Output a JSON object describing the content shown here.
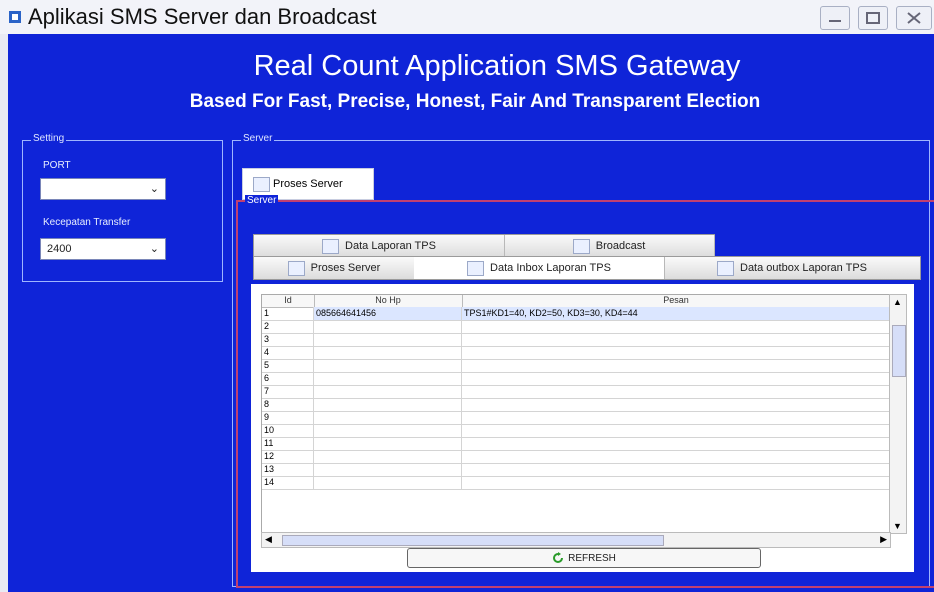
{
  "window": {
    "title": "Aplikasi SMS Server dan Broadcast"
  },
  "header": {
    "title": "Real Count Application SMS Gateway",
    "subtitle": "Based For Fast, Precise, Honest, Fair And Transparent Election"
  },
  "setting": {
    "group_title": "Setting",
    "port_label": "PORT",
    "port_value": "",
    "speed_label": "Kecepatan Transfer",
    "speed_value": "2400"
  },
  "server": {
    "group_title": "Server",
    "top_tab_label": "Proses Server",
    "panel_title": "Server",
    "tabs_row1": [
      "Data Laporan TPS",
      "Broadcast"
    ],
    "tabs_row2": [
      "Proses Server",
      "Data Inbox Laporan TPS",
      "Data outbox Laporan TPS"
    ]
  },
  "table": {
    "columns": [
      "Id",
      "No Hp",
      "Pesan"
    ],
    "rows": [
      {
        "id": "1",
        "phone": "085664641456",
        "message": "TPS1#KD1=40, KD2=50, KD3=30, KD4=44"
      },
      {
        "id": "2",
        "phone": "",
        "message": ""
      },
      {
        "id": "3",
        "phone": "",
        "message": ""
      },
      {
        "id": "4",
        "phone": "",
        "message": ""
      },
      {
        "id": "5",
        "phone": "",
        "message": ""
      },
      {
        "id": "6",
        "phone": "",
        "message": ""
      },
      {
        "id": "7",
        "phone": "",
        "message": ""
      },
      {
        "id": "8",
        "phone": "",
        "message": ""
      },
      {
        "id": "9",
        "phone": "",
        "message": ""
      },
      {
        "id": "10",
        "phone": "",
        "message": ""
      },
      {
        "id": "11",
        "phone": "",
        "message": ""
      },
      {
        "id": "12",
        "phone": "",
        "message": ""
      },
      {
        "id": "13",
        "phone": "",
        "message": ""
      },
      {
        "id": "14",
        "phone": "",
        "message": ""
      }
    ]
  },
  "buttons": {
    "refresh": "REFRESH"
  }
}
